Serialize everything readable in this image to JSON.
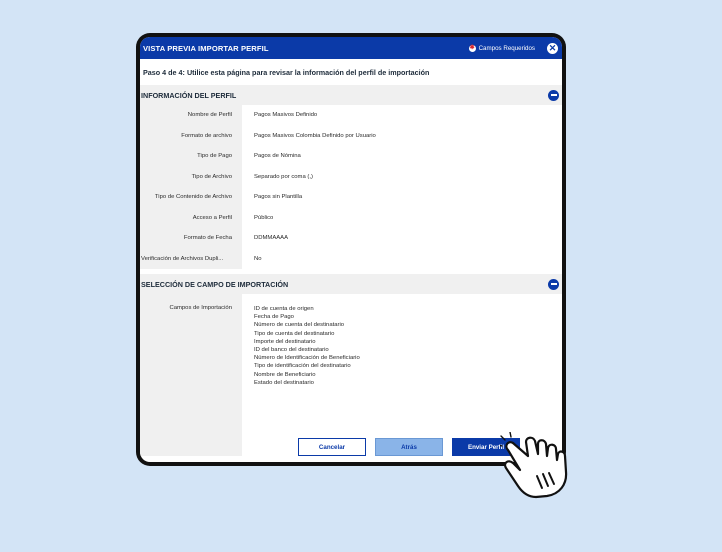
{
  "dialog": {
    "title": "VISTA PREVIA IMPORTAR PERFIL",
    "required_label": "Campos Requeridos",
    "step_text": "Paso 4 de 4:  Utilice esta página para revisar la información del perfil de importación"
  },
  "profile_section": {
    "title": "INFORMACIÓN DEL PERFIL",
    "rows": [
      {
        "label": "Nombre de Perfil",
        "value": "Pagos Masivos Definido"
      },
      {
        "label": "Formato de archivo",
        "value": "Pagos Masivos Colombia Definido por Usuario"
      },
      {
        "label": "Tipo de Pago",
        "value": "Pagos de Nómina"
      },
      {
        "label": "Tipo de Archivo",
        "value": "Separado por coma (,)"
      },
      {
        "label": "Tipo de Contenido de Archivo",
        "value": "Pagos sin Plantilla"
      },
      {
        "label": "Acceso a Perfil",
        "value": "Público"
      },
      {
        "label": "Formato de Fecha",
        "value": "DDMMAAAA"
      },
      {
        "label": "Verificación de Archivos Dupli...",
        "value": "No"
      }
    ]
  },
  "import_section": {
    "title": "SELECCIÓN DE CAMPO DE IMPORTACIÓN",
    "label": "Campos de Importación",
    "fields": [
      "ID de cuenta de origen",
      "Fecha de Pago",
      "Número de cuenta del destinatario",
      "Tipo de cuenta del destinatario",
      "Importe del destinatario",
      "ID del banco del destinatario",
      "Número de Identificación de Beneficiario",
      "Tipo de identificación del destinatario",
      "Nombre de Beneficiario",
      "Estado del destinatario"
    ]
  },
  "buttons": {
    "cancel": "Cancelar",
    "back": "Atrás",
    "send": "Enviar Perfil"
  },
  "icons": {
    "required": "required-asterisk-icon",
    "close": "close-icon",
    "collapse": "minus-circle-icon",
    "cursor": "hand-pointer-icon"
  },
  "colors": {
    "primary": "#0b3aa8",
    "background": "#d3e4f6",
    "back_button": "#8ab4e8",
    "required": "#d6262c"
  }
}
